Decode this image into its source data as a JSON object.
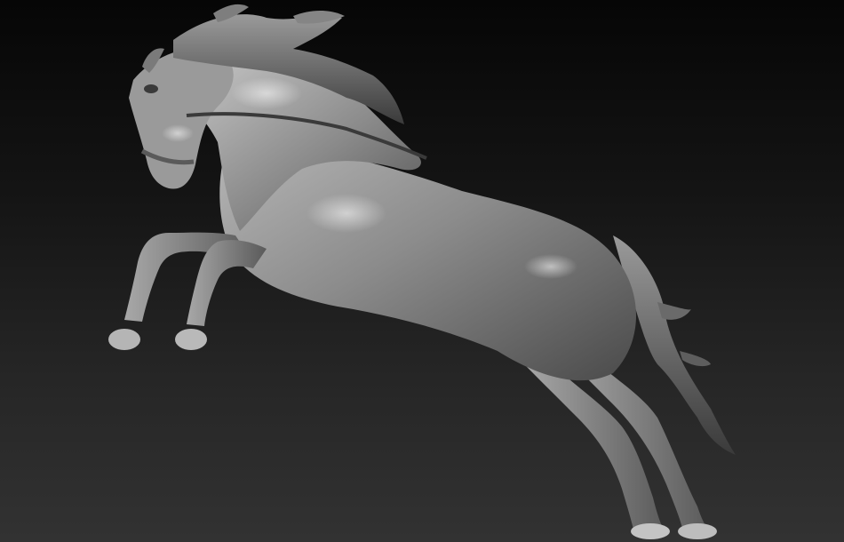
{
  "viewport": {
    "background_top": "#060606",
    "background_bottom": "#323232",
    "model_base_color": "#8a8a8a",
    "model_highlight_color": "#d6d6d6",
    "model_shadow_color": "#2a2a2a"
  },
  "model": {
    "subject": "rearing-horse-sculpt"
  }
}
